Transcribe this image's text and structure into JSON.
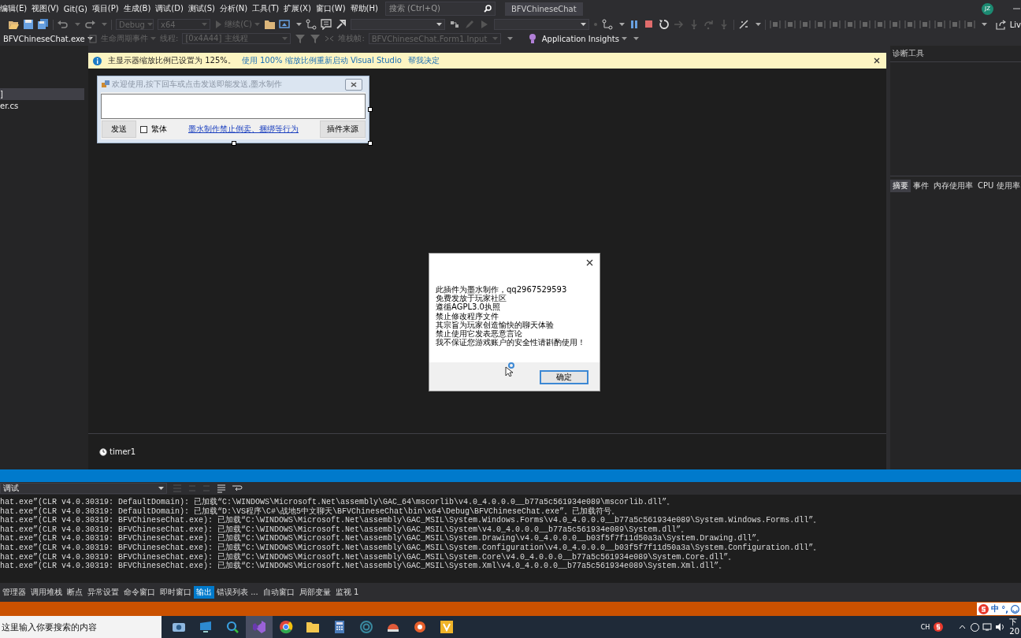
{
  "menu_bar": {
    "items": [
      "编辑(E)",
      "视图(V)",
      "Git(G)",
      "项目(P)",
      "生成(B)",
      "调试(D)",
      "测试(S)",
      "分析(N)",
      "工具(T)",
      "扩展(X)",
      "窗口(W)",
      "帮助(H)"
    ],
    "search": {
      "placeholder": "搜索 (Ctrl+Q)"
    },
    "solution_name": "BFVChineseChat",
    "account_initials": "JZ"
  },
  "toolbar_1": {
    "configuration": "Debug",
    "platform": "x64",
    "continue_button": "继续(C)",
    "live_share": "Liv"
  },
  "toolbar_2": {
    "process": "BFVChineseChat.exe",
    "lifecycle_events": "生命周期事件",
    "thread_label": "线程:",
    "thread": "[0x4A44] 主线程",
    "stack_frame_label": "堆栈帧:",
    "stack_frame": "BFVChineseChat.Form1.Input",
    "application_insights": "Application Insights"
  },
  "info_bar": {
    "message": "主显示器缩放比例已设置为 125%。",
    "links": [
      "使用 100% 缩放比例重新启动 Visual Studio",
      "帮我决定"
    ]
  },
  "solution_explorer": {
    "items": [
      {
        "label": "]",
        "selected": true
      },
      {
        "label": "er.cs",
        "selected": false
      }
    ]
  },
  "designer": {
    "form": {
      "title": "欢迎使用,按下回车或点击发送即能发送,墨水制作",
      "send_button": "发送",
      "traditional_checkbox": {
        "label": "繁体",
        "checked": false
      },
      "link": "墨水制作禁止倒卖、捆绑等行为",
      "source_button": "插件来源"
    },
    "message_box": {
      "lines": [
        "此插件为墨水制作，qq2967529593",
        "免费发放于玩家社区",
        "遵循AGPL3.0执照",
        "禁止修改程序文件",
        "其宗旨为玩家创造愉快的聊天体验",
        "禁止使用它发表恶意言论",
        "我不保证您游戏账户的安全性请斟酌使用！"
      ],
      "ok_button": "确定"
    },
    "component_tray": [
      "timer1"
    ]
  },
  "diagnostic_tools": {
    "title": "诊断工具",
    "tabs": [
      {
        "label": "摘要",
        "selected": true
      },
      {
        "label": "事件",
        "selected": false
      },
      {
        "label": "内存使用率",
        "selected": false
      },
      {
        "label": "CPU 使用率",
        "selected": false
      }
    ]
  },
  "output": {
    "source": "调试",
    "lines": [
      "hat.exe”(CLR v4.0.30319: DefaultDomain): 已加载“C:\\WINDOWS\\Microsoft.Net\\assembly\\GAC_64\\mscorlib\\v4.0_4.0.0.0__b77a5c561934e089\\mscorlib.dll”。",
      "hat.exe”(CLR v4.0.30319: DefaultDomain): 已加载“D:\\VS程序\\C#\\战地5中文聊天\\BFVChineseChat\\bin\\x64\\Debug\\BFVChineseChat.exe”。已加载符号。",
      "hat.exe”(CLR v4.0.30319: BFVChineseChat.exe): 已加载“C:\\WINDOWS\\Microsoft.Net\\assembly\\GAC_MSIL\\System.Windows.Forms\\v4.0_4.0.0.0__b77a5c561934e089\\System.Windows.Forms.dll”。",
      "hat.exe”(CLR v4.0.30319: BFVChineseChat.exe): 已加载“C:\\WINDOWS\\Microsoft.Net\\assembly\\GAC_MSIL\\System\\v4.0_4.0.0.0__b77a5c561934e089\\System.dll”。",
      "hat.exe”(CLR v4.0.30319: BFVChineseChat.exe): 已加载“C:\\WINDOWS\\Microsoft.Net\\assembly\\GAC_MSIL\\System.Drawing\\v4.0_4.0.0.0__b03f5f7f11d50a3a\\System.Drawing.dll”。",
      "hat.exe”(CLR v4.0.30319: BFVChineseChat.exe): 已加载“C:\\WINDOWS\\Microsoft.Net\\assembly\\GAC_MSIL\\System.Configuration\\v4.0_4.0.0.0__b03f5f7f11d50a3a\\System.Configuration.dll”。",
      "hat.exe”(CLR v4.0.30319: BFVChineseChat.exe): 已加载“C:\\WINDOWS\\Microsoft.Net\\assembly\\GAC_MSIL\\System.Core\\v4.0_4.0.0.0__b77a5c561934e089\\System.Core.dll”。",
      "hat.exe”(CLR v4.0.30319: BFVChineseChat.exe): 已加载“C:\\WINDOWS\\Microsoft.Net\\assembly\\GAC_MSIL\\System.Xml\\v4.0_4.0.0.0__b77a5c561934e089\\System.Xml.dll”。"
    ]
  },
  "bottom_tabs": [
    {
      "label": "管理器",
      "selected": false
    },
    {
      "label": "调用堆栈",
      "selected": false
    },
    {
      "label": "断点",
      "selected": false
    },
    {
      "label": "异常设置",
      "selected": false
    },
    {
      "label": "命令窗口",
      "selected": false
    },
    {
      "label": "即时窗口",
      "selected": false
    },
    {
      "label": "输出",
      "selected": true
    },
    {
      "label": "错误列表 ...",
      "selected": false
    },
    {
      "label": "自动窗口",
      "selected": false
    },
    {
      "label": "局部变量",
      "selected": false
    },
    {
      "label": "监视 1",
      "selected": false
    }
  ],
  "status_bar": {
    "ime_mode": "中",
    "ime_punctuation": "°,"
  },
  "taskbar": {
    "search": {
      "placeholder": "这里输入你要搜索的内容"
    },
    "apps": [
      {
        "kind": "camera",
        "selected": false
      },
      {
        "kind": "monitor",
        "selected": false
      },
      {
        "kind": "magnifier",
        "selected": false
      },
      {
        "kind": "ribbon",
        "selected": true
      },
      {
        "kind": "browser",
        "selected": false
      },
      {
        "kind": "folder",
        "selected": false
      },
      {
        "kind": "calculator",
        "selected": false
      },
      {
        "kind": "spiral",
        "selected": false
      },
      {
        "kind": "helmet",
        "selected": false
      },
      {
        "kind": "ring",
        "selected": false
      },
      {
        "kind": "chevron",
        "selected": false
      }
    ],
    "language": "CH",
    "clock_lines": [
      "下",
      "20"
    ]
  }
}
